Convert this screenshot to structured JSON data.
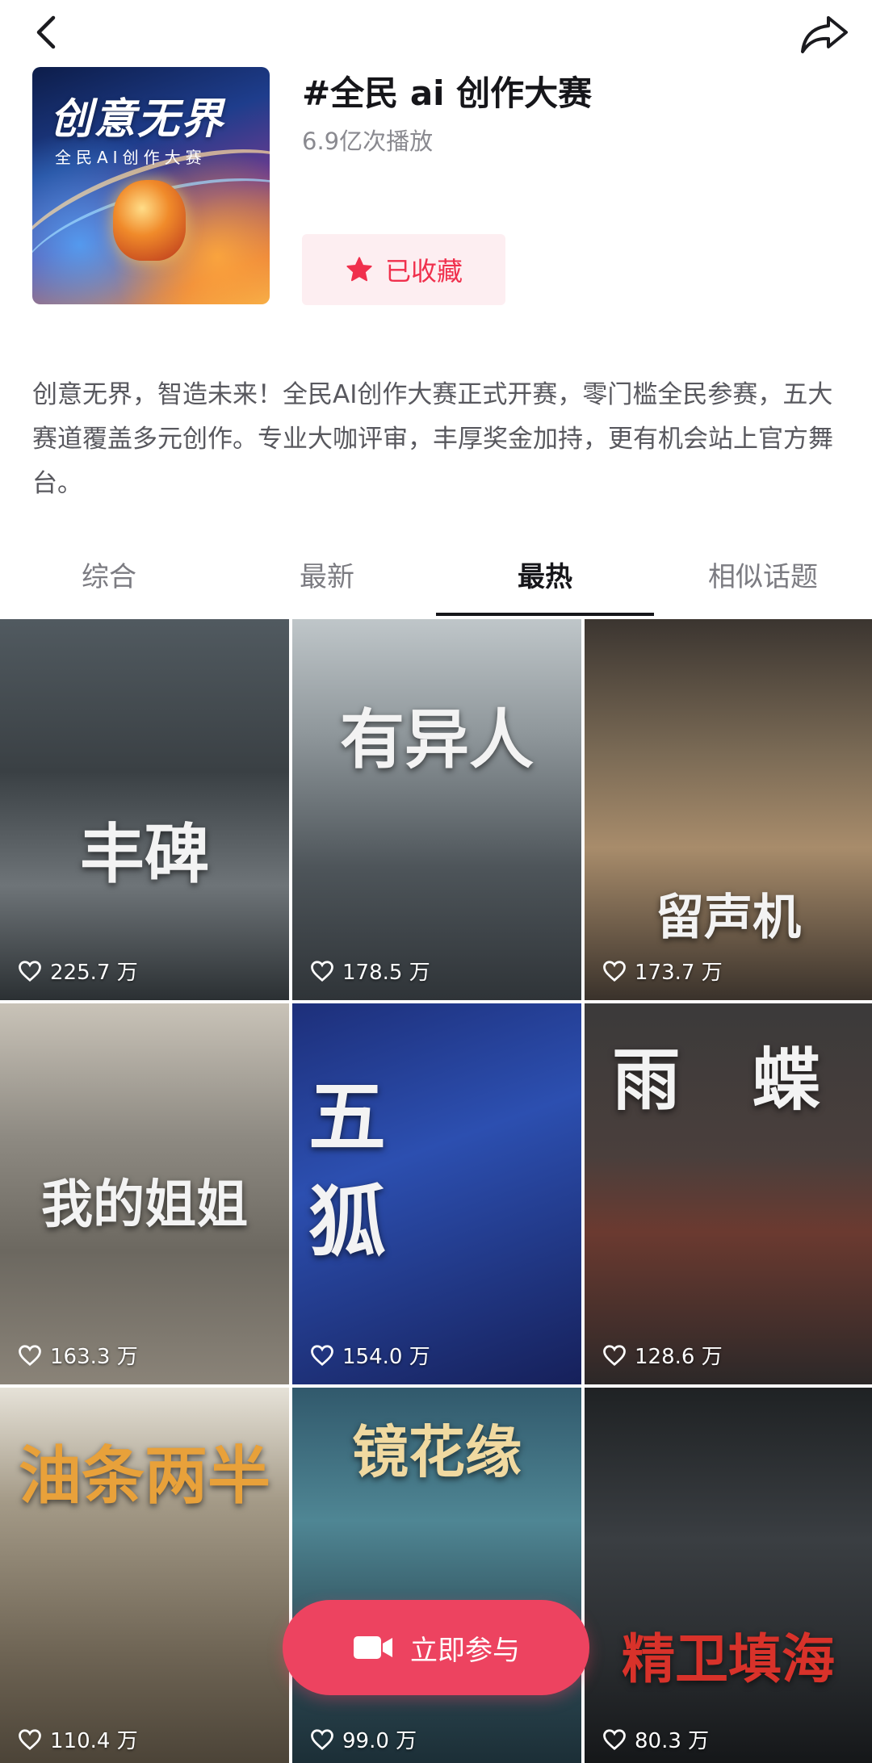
{
  "header": {
    "back_icon": "chevron-left-icon",
    "share_icon": "share-arrow-icon"
  },
  "topic": {
    "cover_title": "创意无界",
    "cover_subtitle": "全民AI创作大赛",
    "title": "#全民 ai 创作大赛",
    "plays": "6.9亿次播放",
    "favorite_label": "已收藏",
    "favorite_icon": "star-icon",
    "accent_color": "#f0304d",
    "description": "创意无界，智造未来！全民AI创作大赛正式开赛，零门槛全民参赛，五大赛道覆盖多元创作。专业大咖评审，丰厚奖金加持，更有机会站上官方舞台。"
  },
  "tabs": [
    {
      "label": "综合",
      "active": false
    },
    {
      "label": "最新",
      "active": false
    },
    {
      "label": "最热",
      "active": true
    },
    {
      "label": "相似话题",
      "active": false
    }
  ],
  "videos": [
    {
      "title": "丰碑",
      "likes": "225.7 万"
    },
    {
      "title": "有异人",
      "likes": "178.5 万"
    },
    {
      "title": "留声机",
      "likes": "173.7 万"
    },
    {
      "title": "我的姐姐",
      "likes": "163.3 万"
    },
    {
      "title": "五狐",
      "likes": "154.0 万"
    },
    {
      "title": "雨 蝶",
      "likes": "128.6 万"
    },
    {
      "title": "油条两半",
      "likes": "110.4 万"
    },
    {
      "title": "镜花缘",
      "likes": "99.0 万"
    },
    {
      "title": "精卫填海",
      "likes": "80.3 万"
    }
  ],
  "join_button": {
    "label": "立即参与",
    "icon": "video-camera-icon",
    "color": "#ed4360"
  }
}
